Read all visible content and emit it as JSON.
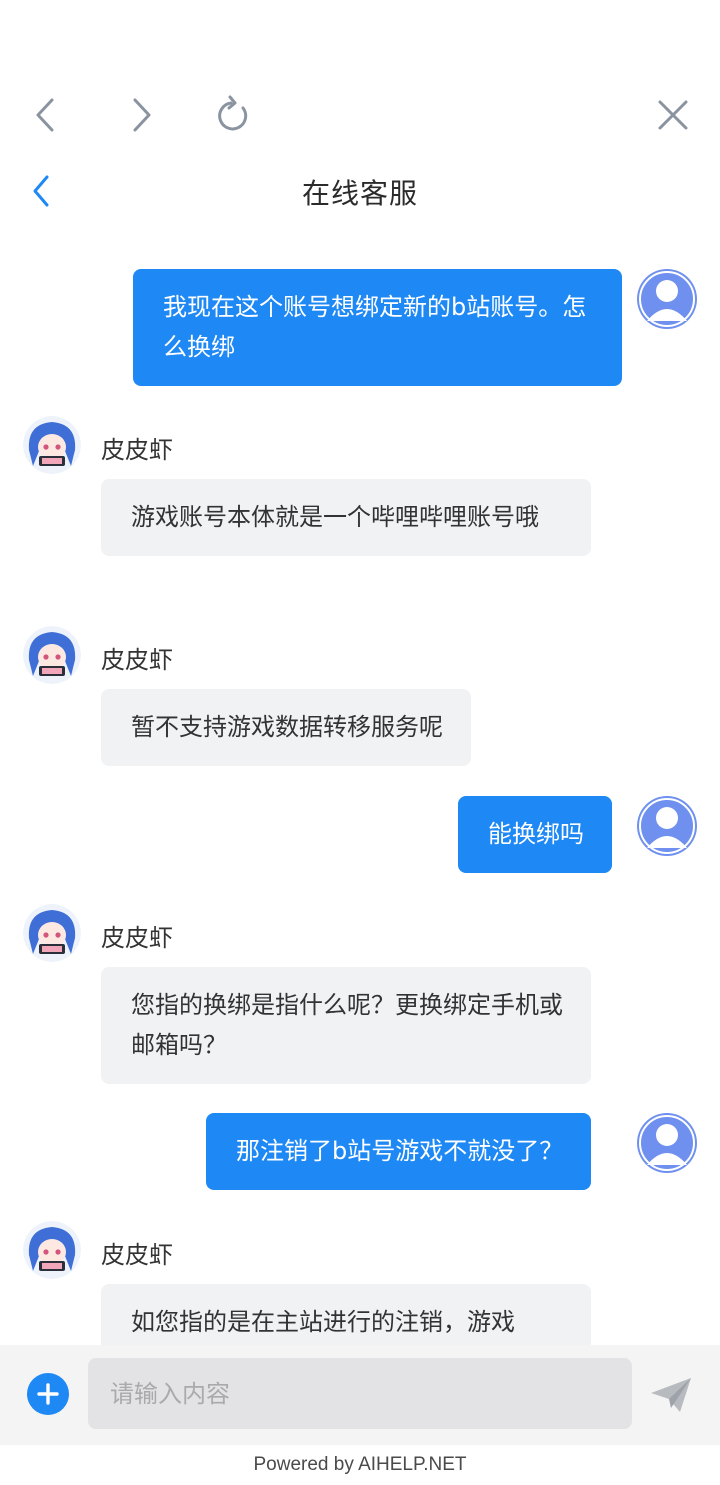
{
  "header": {
    "title": "在线客服"
  },
  "messages": [
    {
      "type": "user",
      "text": "我现在这个账号想绑定新的b站账号。怎么换绑"
    },
    {
      "type": "agent",
      "name": "皮皮虾",
      "text": "游戏账号本体就是一个哔哩哔哩账号哦"
    },
    {
      "type": "agent",
      "name": "皮皮虾",
      "text": "暂不支持游戏数据转移服务呢"
    },
    {
      "type": "user",
      "text": "能换绑吗"
    },
    {
      "type": "agent",
      "name": "皮皮虾",
      "text": "您指的换绑是指什么呢？更换绑定手机或邮箱吗？"
    },
    {
      "type": "user",
      "text": "那注销了b站号游戏不就没了？"
    },
    {
      "type": "agent",
      "name": "皮皮虾",
      "text": "如您指的是在主站进行的注销，游戏"
    }
  ],
  "input": {
    "placeholder": "请输入内容"
  },
  "footer": {
    "text": "Powered by AIHELP.NET"
  },
  "colors": {
    "accent": "#1e88f5",
    "agent_bubble": "#f1f2f4",
    "user_avatar": "#6f90ee"
  },
  "icons": {
    "browser": [
      "back-arrow-icon",
      "forward-arrow-icon",
      "refresh-icon",
      "close-icon"
    ],
    "header": "chevron-left-icon",
    "input": [
      "plus-icon",
      "send-icon"
    ]
  }
}
